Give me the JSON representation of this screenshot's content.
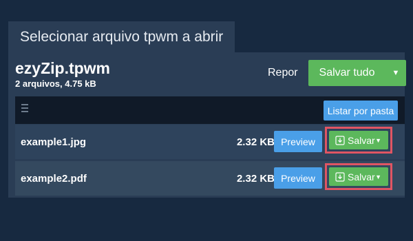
{
  "dialog": {
    "tab_title": "Selecionar arquivo tpwm a abrir"
  },
  "archive": {
    "name": "ezyZip.tpwm",
    "summary": "2 arquivos, 4.75 kB"
  },
  "header_actions": {
    "reset_label": "Repor",
    "save_all_label": "Salvar tudo",
    "save_all_caret": "▼"
  },
  "toolbar": {
    "menu_icon": "hamburger-icon",
    "list_by_folder_label": "Listar por pasta"
  },
  "files": [
    {
      "name": "example1.jpg",
      "size": "2.32 KB",
      "preview_label": "Preview",
      "save_label": "Salvar",
      "save_caret": "▼",
      "save_icon": "download-icon"
    },
    {
      "name": "example2.pdf",
      "size": "2.32 KB",
      "preview_label": "Preview",
      "save_label": "Salvar",
      "save_caret": "▼",
      "save_icon": "download-icon"
    }
  ],
  "colors": {
    "background": "#172940",
    "panel": "#2a3d55",
    "success": "#5cb85c",
    "primary": "#4a9fe8",
    "highlight": "#e05563"
  }
}
